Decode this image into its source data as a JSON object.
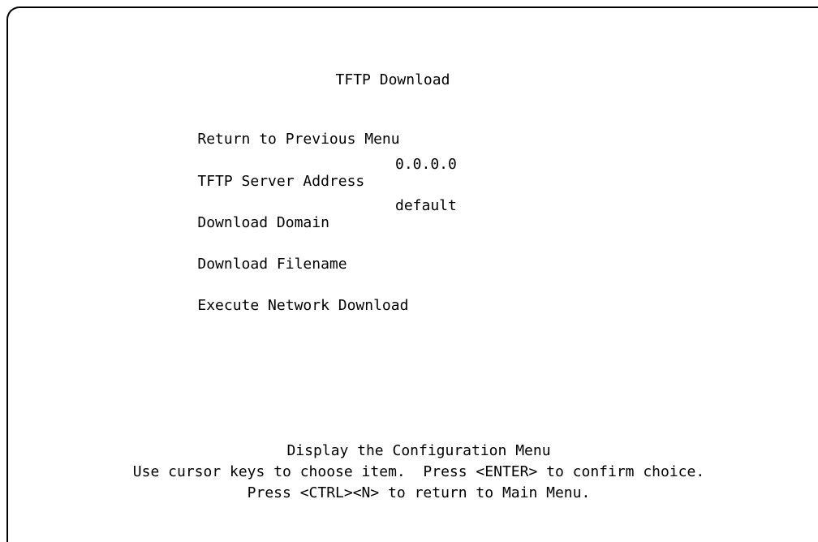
{
  "screen": {
    "title": "TFTP Download"
  },
  "menu": {
    "items": [
      {
        "label": "Return to Previous Menu",
        "value": ""
      },
      {
        "label": "TFTP Server Address",
        "value": "0.0.0.0"
      },
      {
        "label": "Download Domain",
        "value": "default"
      },
      {
        "label": "Download Filename",
        "value": ""
      },
      {
        "label": "Execute Network Download",
        "value": ""
      }
    ]
  },
  "footer": {
    "description": "Display the Configuration Menu",
    "instructions": "Use cursor keys to choose item.  Press <ENTER> to confirm choice.",
    "return_hint": "Press <CTRL><N> to return to Main Menu."
  }
}
